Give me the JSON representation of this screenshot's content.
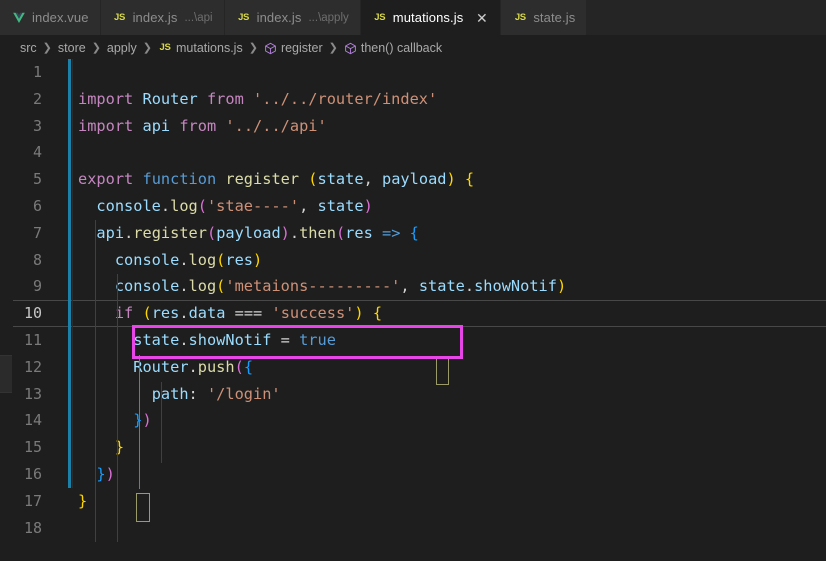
{
  "window": {
    "theme_bg": "#1e1e1e",
    "accent_magenta": "#e845e8",
    "change_bar_color": "#1b81a8"
  },
  "tabs": [
    {
      "icon": "vue-file-icon",
      "name": "index.vue",
      "desc": "",
      "active": false,
      "closable": false
    },
    {
      "icon": "js-file-icon",
      "name": "index.js",
      "desc": "...\\api",
      "active": false,
      "closable": false
    },
    {
      "icon": "js-file-icon",
      "name": "index.js",
      "desc": "...\\apply",
      "active": false,
      "closable": false
    },
    {
      "icon": "js-file-icon",
      "name": "mutations.js",
      "desc": "",
      "active": true,
      "closable": true,
      "close_label": "✕"
    },
    {
      "icon": "js-file-icon",
      "name": "state.js",
      "desc": "",
      "active": false,
      "closable": false
    }
  ],
  "breadcrumb": {
    "separator": "❯",
    "items": [
      {
        "label": "src",
        "icon": ""
      },
      {
        "label": "store",
        "icon": ""
      },
      {
        "label": "apply",
        "icon": ""
      },
      {
        "label": "mutations.js",
        "icon": "js-file-icon"
      },
      {
        "label": "register",
        "icon": "symbol-function-icon"
      },
      {
        "label": "then() callback",
        "icon": "symbol-function-icon"
      }
    ]
  },
  "editor": {
    "current_line": 10,
    "line_numbers": [
      "1",
      "2",
      "3",
      "4",
      "5",
      "6",
      "7",
      "8",
      "9",
      "10",
      "11",
      "12",
      "13",
      "14",
      "15",
      "16",
      "17",
      "18"
    ],
    "lines": [
      {
        "n": "1",
        "text": ""
      },
      {
        "n": "2",
        "text": "import Router from '../../router/index'"
      },
      {
        "n": "3",
        "text": "import api from '../../api'"
      },
      {
        "n": "4",
        "text": ""
      },
      {
        "n": "5",
        "text": "export function register (state, payload) {"
      },
      {
        "n": "6",
        "text": "  console.log('stae----', state)"
      },
      {
        "n": "7",
        "text": "  api.register(payload).then(res => {"
      },
      {
        "n": "8",
        "text": "    console.log(res)"
      },
      {
        "n": "9",
        "text": "    console.log('metaions---------', state.showNotif)"
      },
      {
        "n": "10",
        "text": "    if (res.data === 'success') {"
      },
      {
        "n": "11",
        "text": "      state.showNotif = true"
      },
      {
        "n": "12",
        "text": "      Router.push({"
      },
      {
        "n": "13",
        "text": "        path: '/login'"
      },
      {
        "n": "14",
        "text": "      })"
      },
      {
        "n": "15",
        "text": "    }"
      },
      {
        "n": "16",
        "text": "  })"
      },
      {
        "n": "17",
        "text": "}"
      },
      {
        "n": "18",
        "text": ""
      }
    ]
  },
  "annotation": {
    "target_line": 11,
    "target_text": "state.showNotif = true",
    "color": "#e845e8"
  }
}
